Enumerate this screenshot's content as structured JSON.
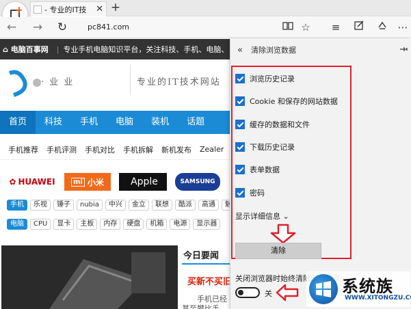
{
  "browser": {
    "tab_title": "- 专业的IT技",
    "url": "pc841.com"
  },
  "site": {
    "topbar_home": "电脑百事网",
    "topbar_text": "专业手机电脑知识平台，关注科技、手机、电脑、",
    "banner_slogan": "专业的IT技术网站",
    "main_nav": [
      "首页",
      "科技",
      "手机",
      "电脑",
      "装机",
      "话题"
    ],
    "sub_nav": [
      "手机推荐",
      "手机评测",
      "手机对比",
      "手机拆解",
      "新机发布",
      "Zealer"
    ],
    "brands": [
      "HUAWEI",
      "小米",
      "Apple",
      "SAMSUNG"
    ],
    "phone_tags": [
      "手机",
      "乐视",
      "锤子",
      "nubia",
      "中兴",
      "金立",
      "联想",
      "酷派",
      "高通",
      "魅"
    ],
    "pc_tags": [
      "电脑",
      "CPU",
      "显卡",
      "主板",
      "内存",
      "硬盘",
      "机箱",
      "电源",
      "显示器"
    ],
    "headlines_title": "今日要闻",
    "headlines_red": "买新不买旧",
    "headlines_grey1": "手机已经",
    "headlines_grey2": "甚至攀比手"
  },
  "panel": {
    "back_icon": "«",
    "title": "清除浏览数据",
    "pin_icon": "pin-icon",
    "options": [
      {
        "label": "浏览历史记录",
        "checked": true
      },
      {
        "label": "Cookie 和保存的网站数据",
        "checked": true
      },
      {
        "label": "缓存的数据和文件",
        "checked": true
      },
      {
        "label": "下载历史记录",
        "checked": true
      },
      {
        "label": "表单数据",
        "checked": true
      },
      {
        "label": "密码",
        "checked": true
      }
    ],
    "more_link": "显示详细信息 ⌄",
    "clear_button": "清除",
    "always_clear_label": "关闭浏览器时始终清除历史记录",
    "toggle_state": "关",
    "highlight_color": "#e0202a",
    "checkbox_color": "#1a6fd0"
  },
  "watermark": {
    "name": "系统族",
    "url": "WWW.XITONGZU.COM"
  }
}
